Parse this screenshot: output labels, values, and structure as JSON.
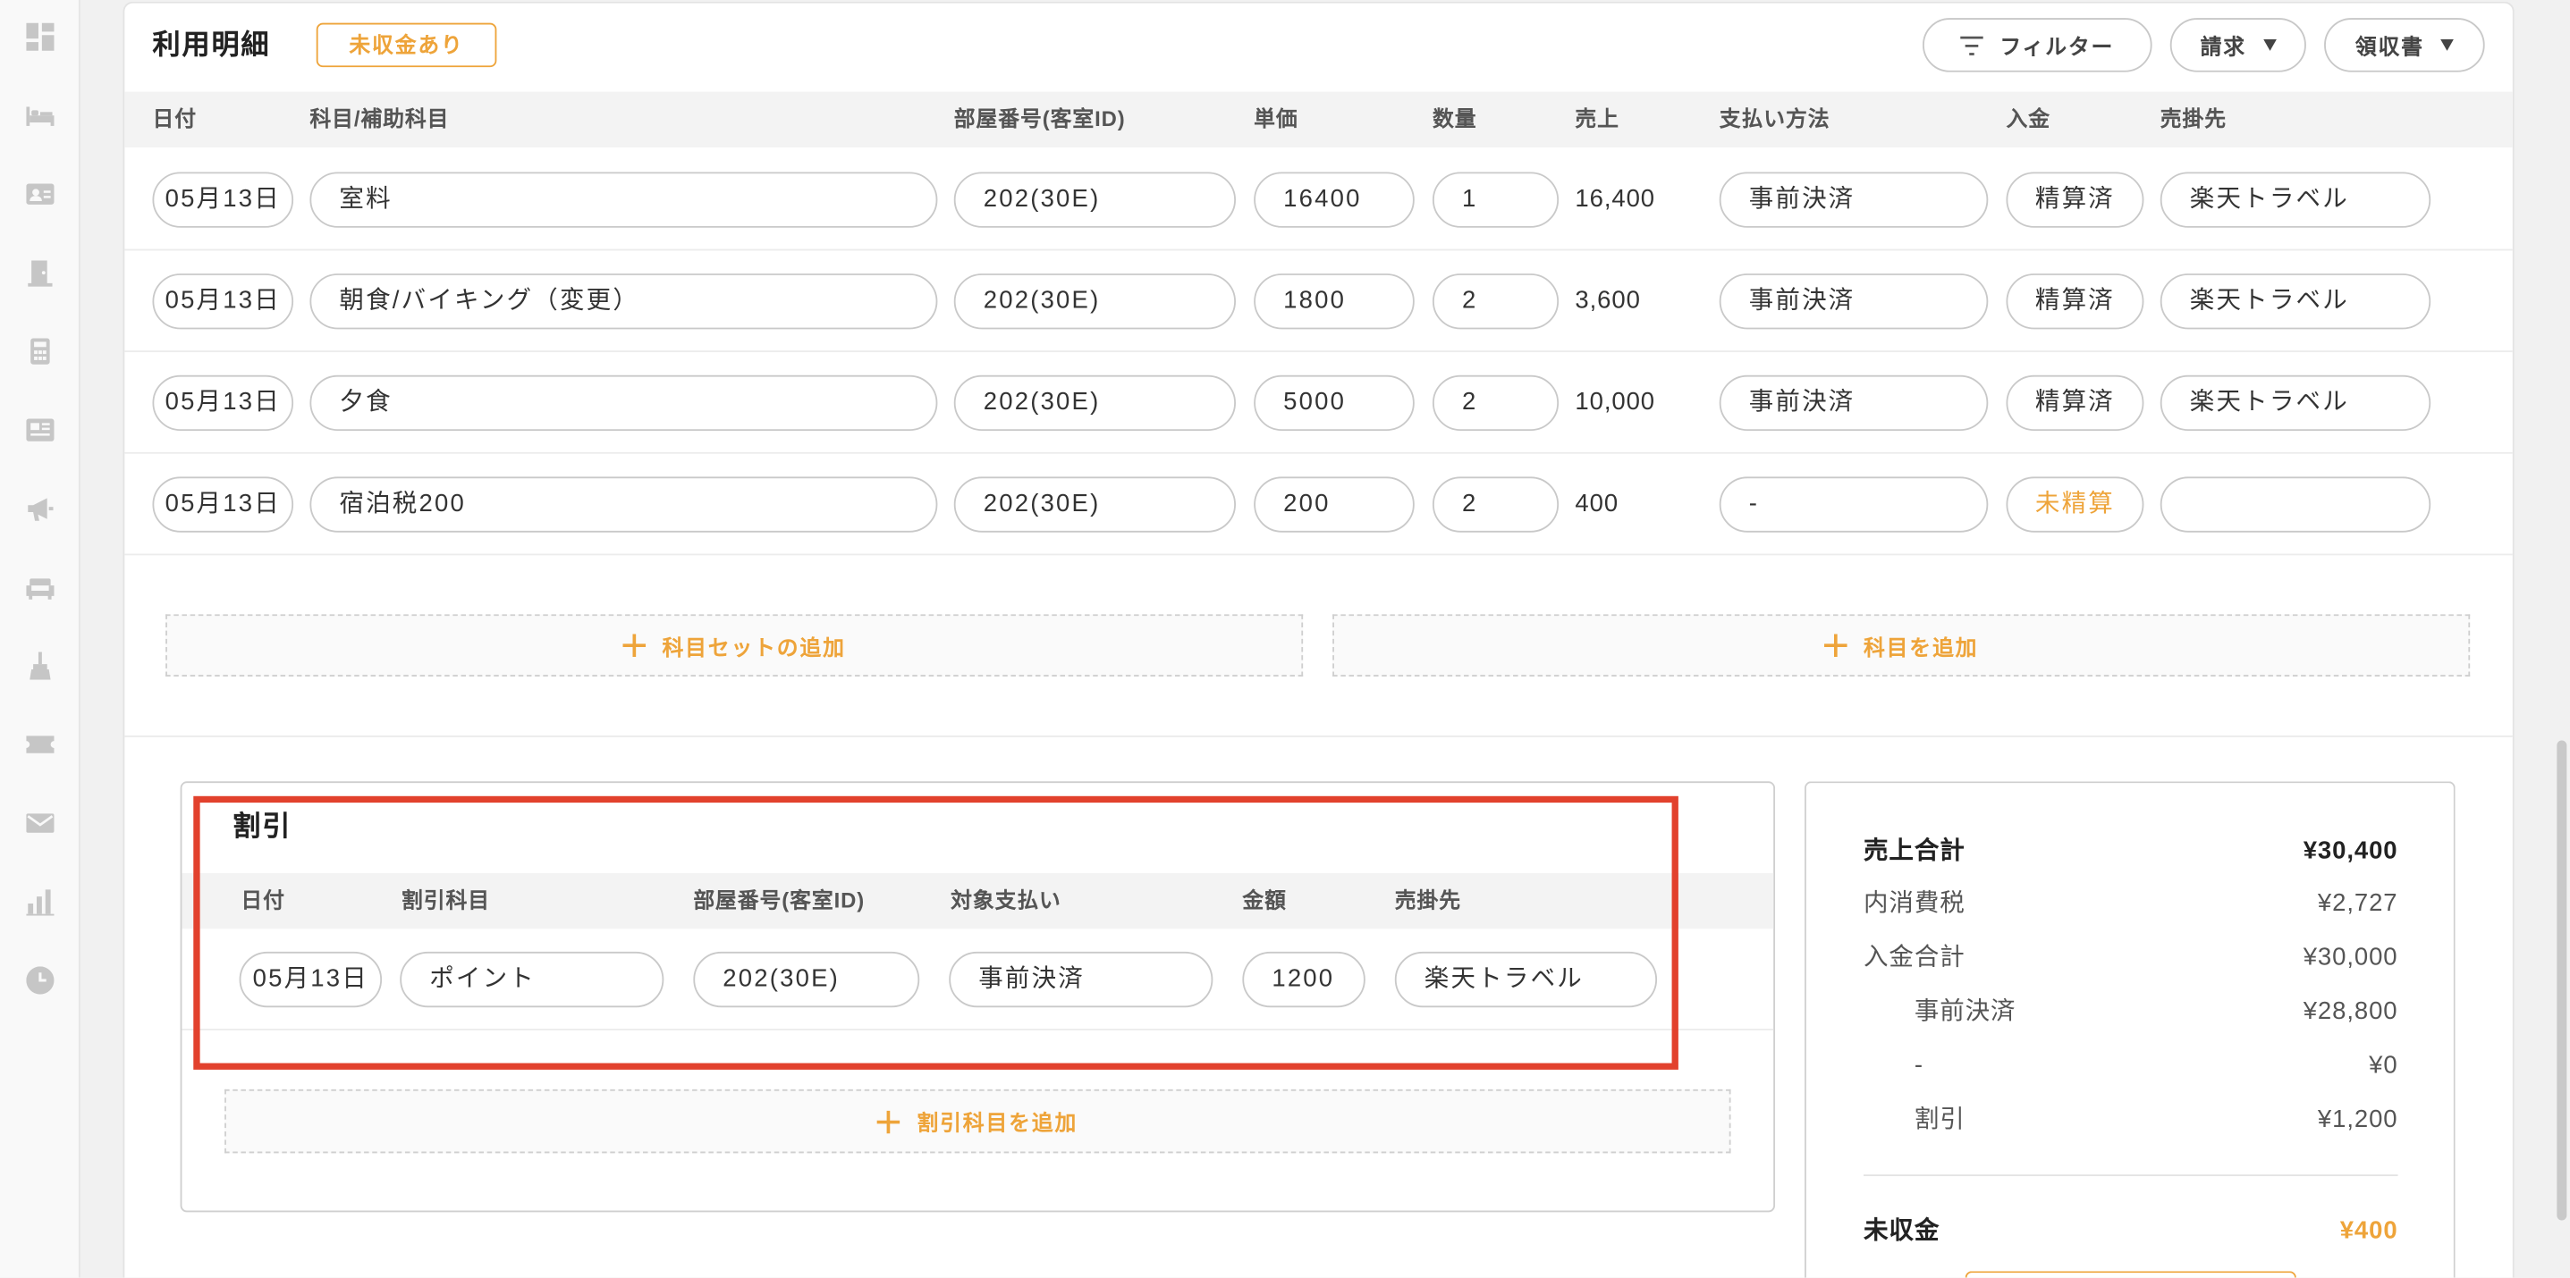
{
  "colors": {
    "accent": "#eea43a",
    "highlight": "#e2412d",
    "border": "#c9c9c9"
  },
  "sidebar": {
    "icons": [
      "dashboard-icon",
      "bed-icon",
      "guest-card-icon",
      "door-icon",
      "calculator-icon",
      "news-icon",
      "megaphone-icon",
      "sofa-icon",
      "broom-icon",
      "ticket-icon",
      "mail-icon",
      "bar-chart-icon",
      "clock-icon"
    ]
  },
  "header": {
    "title": "利用明細",
    "badge": "未収金あり",
    "filter_label": "フィルター",
    "invoice_label": "請求",
    "receipt_label": "領収書"
  },
  "table": {
    "columns": [
      "日付",
      "科目/補助科目",
      "部屋番号(客室ID)",
      "単価",
      "数量",
      "売上",
      "支払い方法",
      "入金",
      "売掛先"
    ],
    "rows": [
      {
        "date": "05月13日",
        "item": "室料",
        "room": "202(30E)",
        "unit_price": "16400",
        "quantity": "1",
        "sales": "16,400",
        "payment_method": "事前決済",
        "deposit": "精算済",
        "receivable": "楽天トラベル"
      },
      {
        "date": "05月13日",
        "item": "朝食/バイキング（変更）",
        "room": "202(30E)",
        "unit_price": "1800",
        "quantity": "2",
        "sales": "3,600",
        "payment_method": "事前決済",
        "deposit": "精算済",
        "receivable": "楽天トラベル"
      },
      {
        "date": "05月13日",
        "item": "夕食",
        "room": "202(30E)",
        "unit_price": "5000",
        "quantity": "2",
        "sales": "10,000",
        "payment_method": "事前決済",
        "deposit": "精算済",
        "receivable": "楽天トラベル"
      },
      {
        "date": "05月13日",
        "item": "宿泊税200",
        "room": "202(30E)",
        "unit_price": "200",
        "quantity": "2",
        "sales": "400",
        "payment_method": "-",
        "deposit": "未精算",
        "receivable": ""
      }
    ],
    "add_item_set_label": "科目セットの追加",
    "add_item_label": "科目を追加"
  },
  "discount": {
    "title": "割引",
    "columns": [
      "日付",
      "割引科目",
      "部屋番号(客室ID)",
      "対象支払い",
      "金額",
      "売掛先"
    ],
    "rows": [
      {
        "date": "05月13日",
        "item": "ポイント",
        "room": "202(30E)",
        "target_payment": "事前決済",
        "amount": "1200",
        "receivable": "楽天トラベル"
      }
    ],
    "add_label": "割引科目を追加"
  },
  "summary": {
    "sales_total": {
      "label": "売上合計",
      "value": "¥30,400"
    },
    "consumption_tax": {
      "label": "内消費税",
      "value": "¥2,727"
    },
    "deposit_total": {
      "label": "入金合計",
      "value": "¥30,000"
    },
    "prepaid": {
      "label": "事前決済",
      "value": "¥28,800"
    },
    "none": {
      "label": "-",
      "value": "¥0"
    },
    "discount": {
      "label": "割引",
      "value": "¥1,200"
    },
    "outstanding": {
      "label": "未収金",
      "value": "¥400"
    }
  }
}
